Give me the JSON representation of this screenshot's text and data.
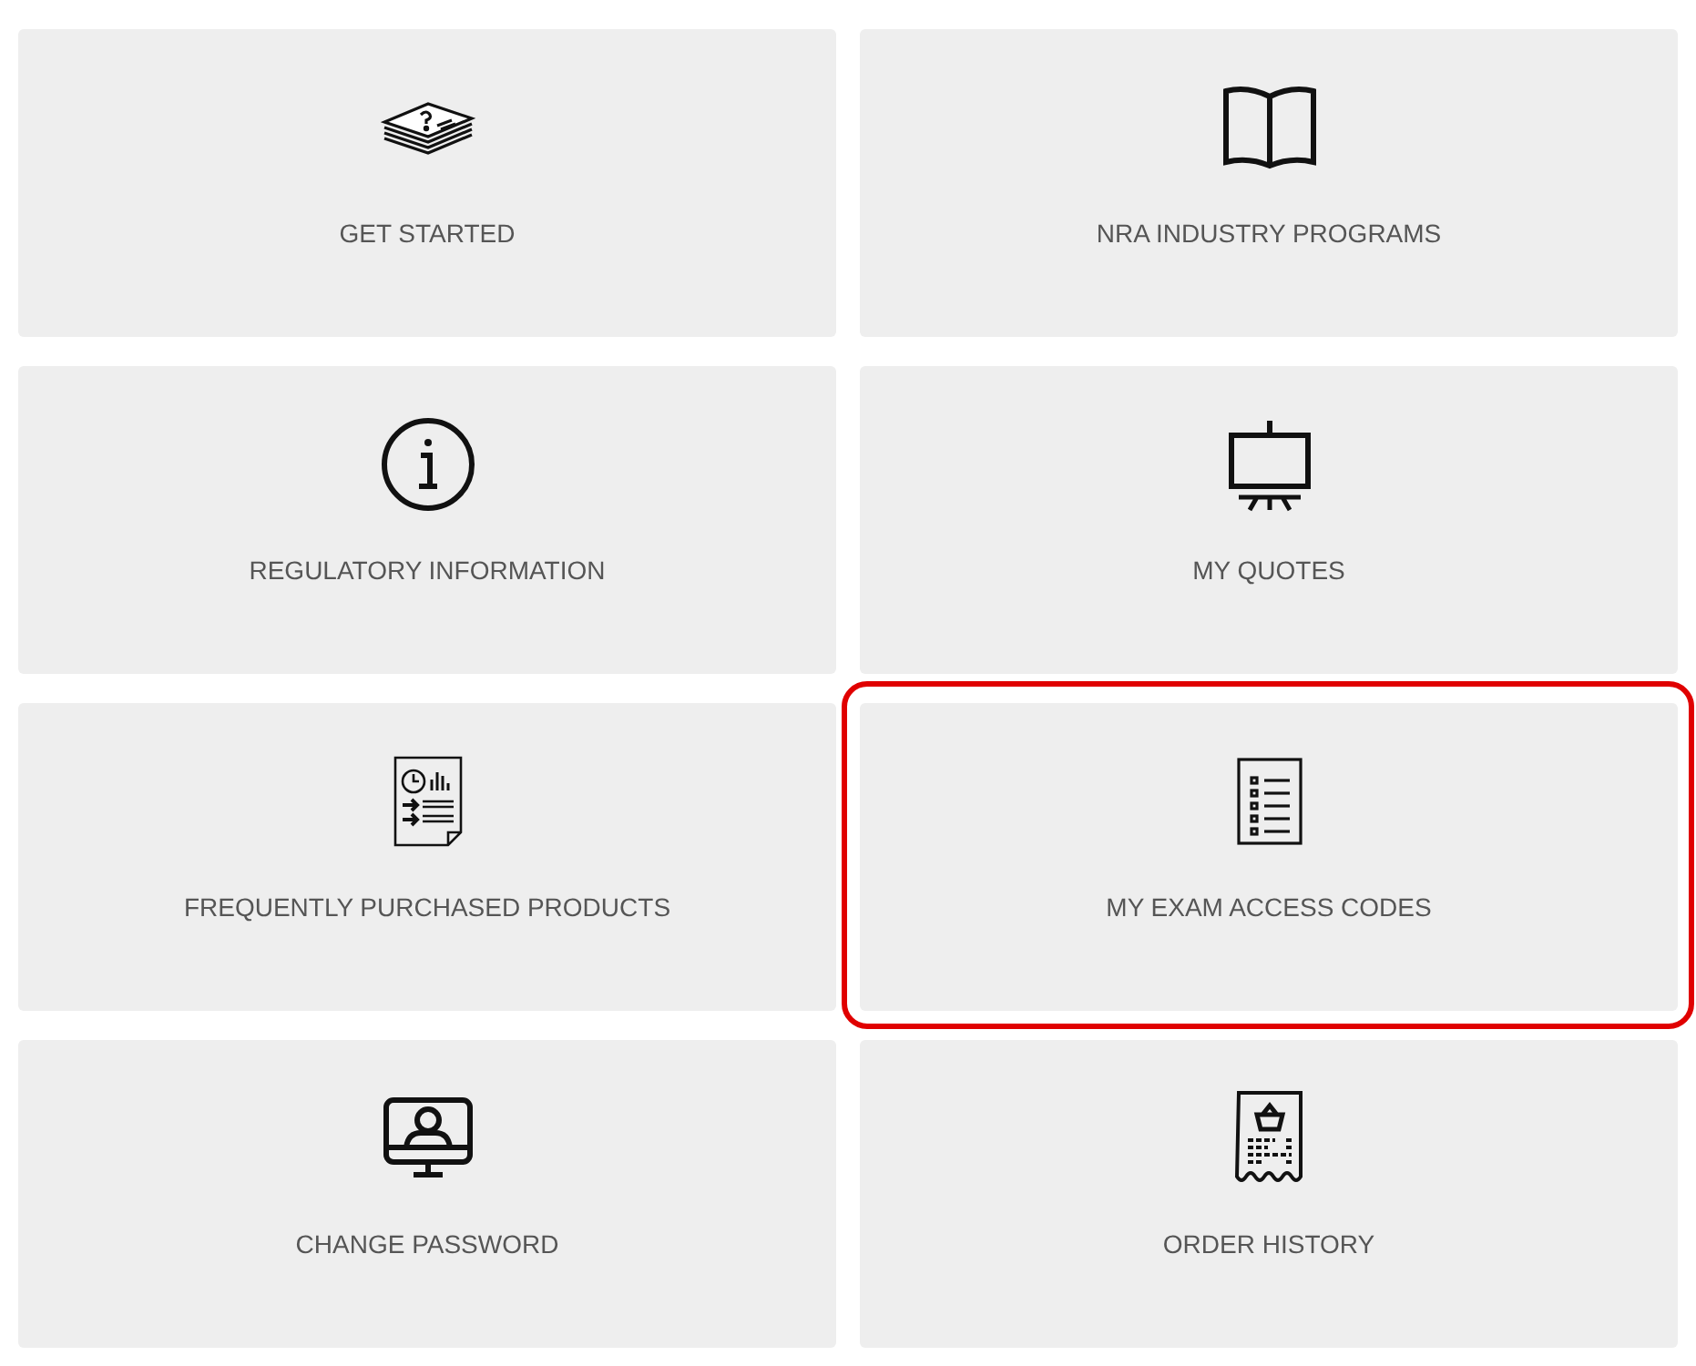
{
  "tiles": [
    {
      "label": "GET STARTED",
      "kind": "papers",
      "highlighted": false
    },
    {
      "label": "NRA INDUSTRY PROGRAMS",
      "kind": "book",
      "highlighted": false
    },
    {
      "label": "REGULATORY INFORMATION",
      "kind": "info",
      "highlighted": false
    },
    {
      "label": "MY QUOTES",
      "kind": "easel",
      "highlighted": false
    },
    {
      "label": "FREQUENTLY PURCHASED PRODUCTS",
      "kind": "report",
      "highlighted": false
    },
    {
      "label": "MY EXAM ACCESS CODES",
      "kind": "checklist",
      "highlighted": true
    },
    {
      "label": "CHANGE PASSWORD",
      "kind": "monitor",
      "highlighted": false
    },
    {
      "label": "ORDER HISTORY",
      "kind": "receipt",
      "highlighted": false
    }
  ]
}
